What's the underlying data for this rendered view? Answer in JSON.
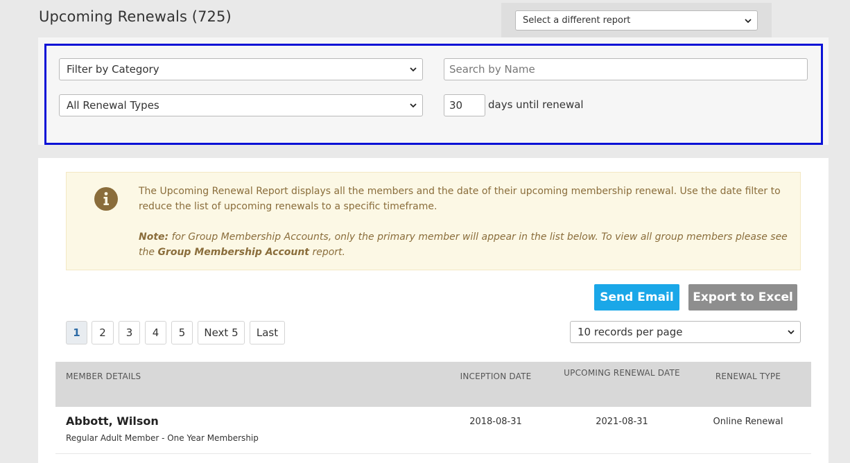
{
  "page": {
    "title": "Upcoming Renewals (725)",
    "report_select": {
      "value": "Select a different report"
    }
  },
  "filters": {
    "category_select": {
      "value": "Filter by Category"
    },
    "search": {
      "placeholder": "Search by Name",
      "value": ""
    },
    "type_select": {
      "value": "All Renewal Types"
    },
    "days": {
      "value": "30",
      "label": "days until renewal"
    }
  },
  "notice": {
    "icon": "info-icon",
    "paragraph1": "The Upcoming Renewal Report displays all the members and the date of their upcoming membership renewal. Use the date filter to reduce the list of upcoming renewals to a specific timeframe.",
    "note_label": "Note:",
    "note_text": " for Group Membership Accounts, only the primary member will appear in the list below. To view all group members please see the ",
    "note_link": "Group Membership Account",
    "note_end": " report."
  },
  "actions": {
    "send_email": "Send Email",
    "export_excel": "Export to Excel"
  },
  "pagination": {
    "pages": [
      "1",
      "2",
      "3",
      "4",
      "5"
    ],
    "active": "1",
    "next": "Next 5",
    "last": "Last",
    "per_page": "10 records per page"
  },
  "table": {
    "headers": {
      "member": "MEMBER DETAILS",
      "inception": "INCEPTION DATE",
      "renewal": "UPCOMING RENEWAL DATE",
      "type": "RENEWAL TYPE"
    },
    "rows": [
      {
        "name": "Abbott, Wilson",
        "membership": "Regular Adult Member - One Year Membership",
        "inception": "2018-08-31",
        "renewal": "2021-08-31",
        "type": "Online Renewal"
      }
    ]
  },
  "colors": {
    "highlight_outline": "#0a12d6",
    "send_email": "#1aa7e8",
    "export": "#8e8e8e",
    "notice_bg": "#fcf8e5",
    "notice_text": "#8a6d3b"
  }
}
